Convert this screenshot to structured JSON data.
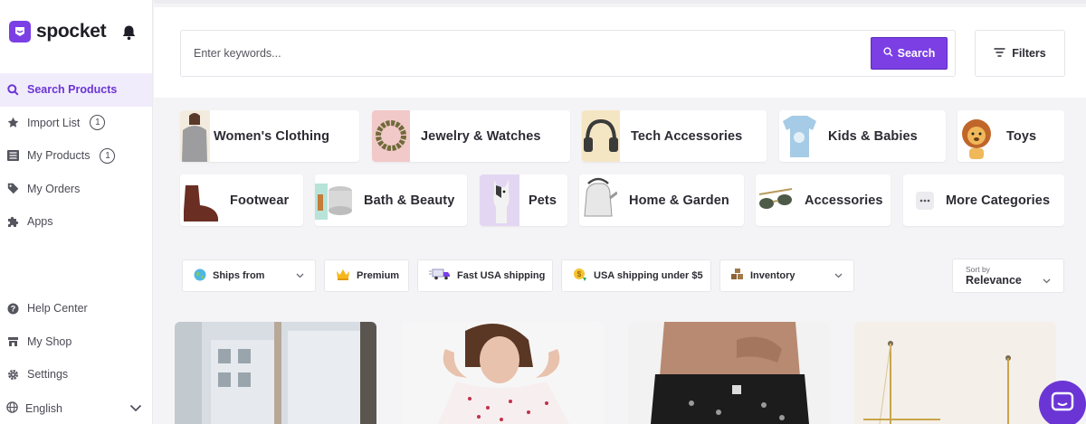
{
  "app": {
    "name": "spocket",
    "brand_color": "#7b3fe4"
  },
  "sidebar": {
    "items": [
      {
        "label": "Search Products",
        "icon": "search-icon",
        "active": true
      },
      {
        "label": "Import List",
        "icon": "star-icon",
        "badge": "1"
      },
      {
        "label": "My Products",
        "icon": "list-icon",
        "badge": "1"
      },
      {
        "label": "My Orders",
        "icon": "tag-icon"
      },
      {
        "label": "Apps",
        "icon": "puzzle-icon"
      }
    ],
    "bottom_items": [
      {
        "label": "Help Center",
        "icon": "help-icon"
      },
      {
        "label": "My Shop",
        "icon": "shop-icon"
      },
      {
        "label": "Settings",
        "icon": "gear-icon"
      }
    ],
    "language": "English"
  },
  "search": {
    "placeholder": "Enter keywords...",
    "button_label": "Search",
    "filters_label": "Filters"
  },
  "categories": [
    {
      "label": "Women's Clothing"
    },
    {
      "label": "Jewelry & Watches"
    },
    {
      "label": "Tech Accessories"
    },
    {
      "label": "Kids & Babies"
    },
    {
      "label": "Toys"
    },
    {
      "label": "Footwear"
    },
    {
      "label": "Bath & Beauty"
    },
    {
      "label": "Pets"
    },
    {
      "label": "Home & Garden"
    },
    {
      "label": "Accessories"
    },
    {
      "label": "More Categories"
    }
  ],
  "filter_chips": [
    {
      "label": "Ships from",
      "icon": "globe-icon",
      "dropdown": true
    },
    {
      "label": "Premium",
      "icon": "crown-icon"
    },
    {
      "label": "Fast USA shipping",
      "icon": "truck-icon"
    },
    {
      "label": "USA shipping under $5",
      "icon": "coin-icon"
    },
    {
      "label": "Inventory",
      "icon": "boxes-icon",
      "dropdown": true
    }
  ],
  "sort": {
    "caption": "Sort by",
    "value": "Relevance"
  }
}
